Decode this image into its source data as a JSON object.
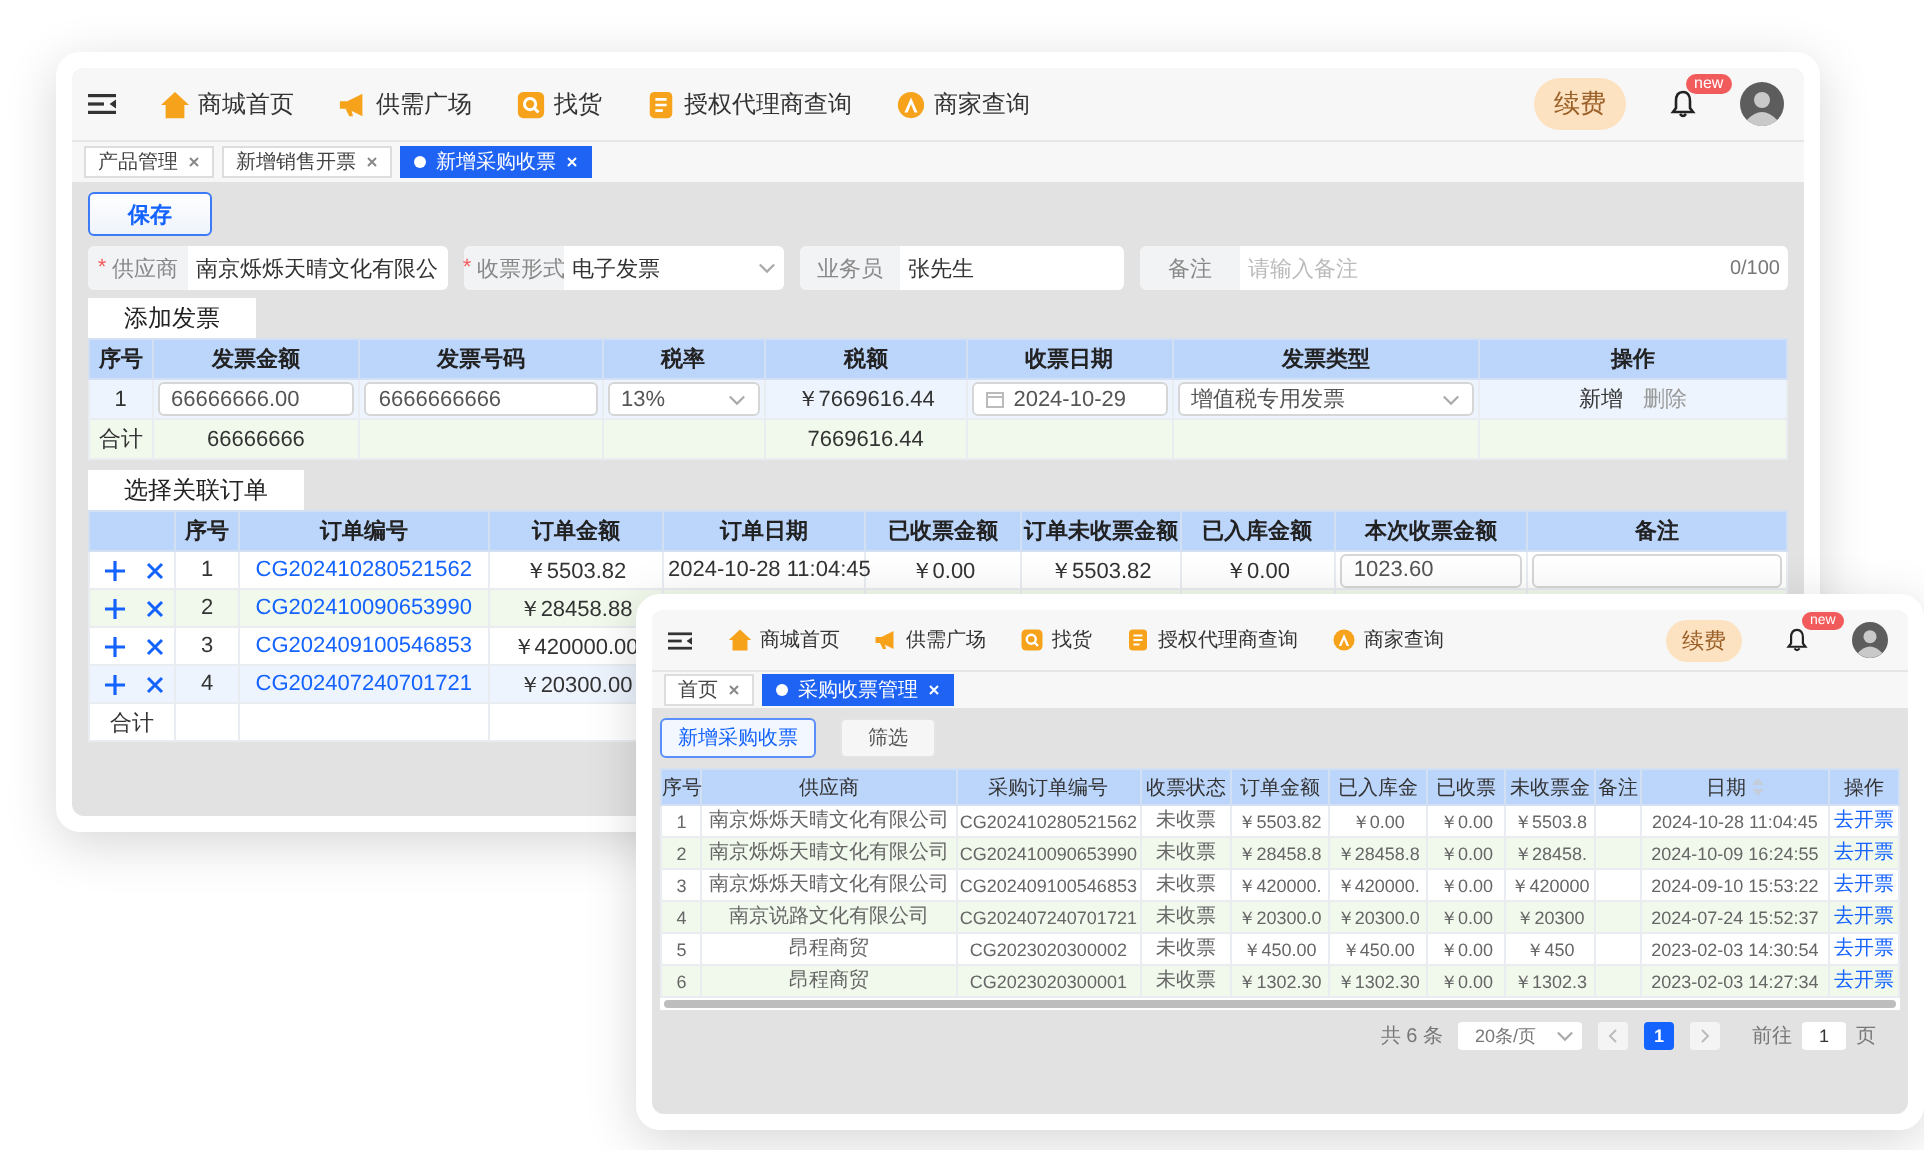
{
  "main_window": {
    "nav": {
      "items": [
        "商城首页",
        "供需广场",
        "找货",
        "授权代理商查询",
        "商家查询"
      ],
      "renew": "续费",
      "badge": "new"
    },
    "tabs": [
      {
        "label": "产品管理",
        "selected": false
      },
      {
        "label": "新增销售开票",
        "selected": false
      },
      {
        "label": "新增采购收票",
        "selected": true
      }
    ],
    "save_button": "保存",
    "form_fields": [
      {
        "kind": "text",
        "required_mark": "*",
        "label": "供应商",
        "value": "南京烁烁天晴文化有限公"
      },
      {
        "kind": "select",
        "required_mark": "*",
        "label": "收票形式",
        "value": "电子发票"
      },
      {
        "kind": "text",
        "label": "业务员",
        "value": "张先生"
      },
      {
        "kind": "text",
        "label": "备注",
        "placeholder": "请输入备注",
        "counter": "0/100"
      }
    ],
    "invoice_section": {
      "title": "添加发票",
      "columns": [
        "序号",
        "发票金额",
        "发票号码",
        "税率",
        "税额",
        "收票日期",
        "发票类型",
        "操作"
      ],
      "rows": [
        {
          "highlighted": true,
          "cells": [
            {
              "kind": "text",
              "text": "1"
            },
            {
              "kind": "input",
              "value": "66666666.00"
            },
            {
              "kind": "input",
              "value": "6666666666"
            },
            {
              "kind": "select",
              "value": "13%"
            },
            {
              "kind": "text",
              "text": "￥7669616.44"
            },
            {
              "kind": "date",
              "value": "2024-10-29"
            },
            {
              "kind": "select",
              "value": "增值税专用发票"
            },
            {
              "kind": "actions",
              "actions": [
                {
                  "label": "新增",
                  "disabled": false
                },
                {
                  "label": "删除",
                  "disabled": true
                }
              ]
            }
          ]
        },
        {
          "highlighted": false,
          "cells": [
            {
              "kind": "text",
              "text": "合计"
            },
            {
              "kind": "text",
              "text": "66666666"
            },
            {
              "kind": "empty"
            },
            {
              "kind": "empty"
            },
            {
              "kind": "text",
              "text": "7669616.44"
            }
          ]
        }
      ]
    },
    "order_section": {
      "title": "选择关联订单",
      "columns": [
        "",
        "序号",
        "订单编号",
        "订单金额",
        "订单日期",
        "已收票金额",
        "订单未收票金额",
        "已入库金额",
        "本次收票金额",
        "备注"
      ],
      "rows": [
        {
          "highlighted": false,
          "cells": [
            {
              "kind": "controls"
            },
            {
              "kind": "text",
              "text": "1"
            },
            {
              "kind": "link",
              "text": "CG202410280521562"
            },
            {
              "kind": "text",
              "text": "￥5503.82"
            },
            {
              "kind": "text",
              "text": "2024-10-28 11:04:45"
            },
            {
              "kind": "text",
              "text": "￥0.00"
            },
            {
              "kind": "text",
              "text": "￥5503.82"
            },
            {
              "kind": "text",
              "text": "￥0.00"
            },
            {
              "kind": "input",
              "value": "1023.60"
            },
            {
              "kind": "input"
            }
          ]
        },
        {
          "highlighted": false,
          "cells": [
            {
              "kind": "controls"
            },
            {
              "kind": "text",
              "text": "2"
            },
            {
              "kind": "link",
              "text": "CG202410090653990"
            },
            {
              "kind": "text",
              "text": "￥28458.88"
            }
          ]
        },
        {
          "highlighted": false,
          "cells": [
            {
              "kind": "controls"
            },
            {
              "kind": "text",
              "text": "3"
            },
            {
              "kind": "link",
              "text": "CG202409100546853"
            },
            {
              "kind": "text",
              "text": "￥420000.00"
            }
          ]
        },
        {
          "highlighted": true,
          "cells": [
            {
              "kind": "controls"
            },
            {
              "kind": "text",
              "text": "4"
            },
            {
              "kind": "link",
              "text": "CG202407240701721"
            },
            {
              "kind": "text",
              "text": "￥20300.00"
            }
          ]
        },
        {
          "highlighted": false,
          "cells": [
            {
              "kind": "text",
              "text": "合计"
            }
          ]
        }
      ]
    }
  },
  "second_window": {
    "nav": {
      "items": [
        "商城首页",
        "供需广场",
        "找货",
        "授权代理商查询",
        "商家查询"
      ],
      "renew": "续费",
      "badge": "new"
    },
    "tabs": [
      {
        "label": "首页",
        "selected": false
      },
      {
        "label": "采购收票管理",
        "selected": true
      }
    ],
    "buttons": [
      {
        "label": "新增采购收票",
        "kind": "primary"
      },
      {
        "label": "筛选",
        "kind": "plain"
      }
    ],
    "columns": [
      {
        "label": "序号"
      },
      {
        "label": "供应商"
      },
      {
        "label": "采购订单编号"
      },
      {
        "label": "收票状态"
      },
      {
        "label": "订单金额"
      },
      {
        "label": "已入库金"
      },
      {
        "label": "已收票"
      },
      {
        "label": "未收票金"
      },
      {
        "label": "备注"
      },
      {
        "label": "日期",
        "sortable": true
      },
      {
        "label": "操作"
      }
    ],
    "rows": [
      {
        "cells": [
          {
            "kind": "text",
            "text": "1"
          },
          {
            "kind": "text",
            "text": "南京烁烁天晴文化有限公司"
          },
          {
            "kind": "text",
            "text": "CG202410280521562"
          },
          {
            "kind": "text",
            "text": "未收票"
          },
          {
            "kind": "text",
            "text": "￥5503.82"
          },
          {
            "kind": "text",
            "text": "￥0.00"
          },
          {
            "kind": "text",
            "text": "￥0.00"
          },
          {
            "kind": "text",
            "text": "￥5503.8"
          },
          {
            "kind": "empty"
          },
          {
            "kind": "text",
            "text": "2024-10-28 11:04:45"
          },
          {
            "kind": "link",
            "text": "去开票"
          }
        ]
      },
      {
        "cells": [
          {
            "kind": "text",
            "text": "2"
          },
          {
            "kind": "text",
            "text": "南京烁烁天晴文化有限公司"
          },
          {
            "kind": "text",
            "text": "CG202410090653990"
          },
          {
            "kind": "text",
            "text": "未收票"
          },
          {
            "kind": "text",
            "text": "￥28458.8"
          },
          {
            "kind": "text",
            "text": "￥28458.8"
          },
          {
            "kind": "text",
            "text": "￥0.00"
          },
          {
            "kind": "text",
            "text": "￥28458."
          },
          {
            "kind": "empty"
          },
          {
            "kind": "text",
            "text": "2024-10-09 16:24:55"
          },
          {
            "kind": "link",
            "text": "去开票"
          }
        ]
      },
      {
        "cells": [
          {
            "kind": "text",
            "text": "3"
          },
          {
            "kind": "text",
            "text": "南京烁烁天晴文化有限公司"
          },
          {
            "kind": "text",
            "text": "CG202409100546853"
          },
          {
            "kind": "text",
            "text": "未收票"
          },
          {
            "kind": "text",
            "text": "￥420000."
          },
          {
            "kind": "text",
            "text": "￥420000."
          },
          {
            "kind": "text",
            "text": "￥0.00"
          },
          {
            "kind": "text",
            "text": "￥420000"
          },
          {
            "kind": "empty"
          },
          {
            "kind": "text",
            "text": "2024-09-10 15:53:22"
          },
          {
            "kind": "link",
            "text": "去开票"
          }
        ]
      },
      {
        "cells": [
          {
            "kind": "text",
            "text": "4"
          },
          {
            "kind": "text",
            "text": "南京说路文化有限公司"
          },
          {
            "kind": "text",
            "text": "CG202407240701721"
          },
          {
            "kind": "text",
            "text": "未收票"
          },
          {
            "kind": "text",
            "text": "￥20300.0"
          },
          {
            "kind": "text",
            "text": "￥20300.0"
          },
          {
            "kind": "text",
            "text": "￥0.00"
          },
          {
            "kind": "text",
            "text": "￥20300"
          },
          {
            "kind": "empty"
          },
          {
            "kind": "text",
            "text": "2024-07-24 15:52:37"
          },
          {
            "kind": "link",
            "text": "去开票"
          }
        ]
      },
      {
        "cells": [
          {
            "kind": "text",
            "text": "5"
          },
          {
            "kind": "text",
            "text": "昂程商贸"
          },
          {
            "kind": "text",
            "text": "CG2023020300002"
          },
          {
            "kind": "text",
            "text": "未收票"
          },
          {
            "kind": "text",
            "text": "￥450.00"
          },
          {
            "kind": "text",
            "text": "￥450.00"
          },
          {
            "kind": "text",
            "text": "￥0.00"
          },
          {
            "kind": "text",
            "text": "￥450"
          },
          {
            "kind": "empty"
          },
          {
            "kind": "text",
            "text": "2023-02-03 14:30:54"
          },
          {
            "kind": "link",
            "text": "去开票"
          }
        ]
      },
      {
        "cells": [
          {
            "kind": "text",
            "text": "6"
          },
          {
            "kind": "text",
            "text": "昂程商贸"
          },
          {
            "kind": "text",
            "text": "CG2023020300001"
          },
          {
            "kind": "text",
            "text": "未收票"
          },
          {
            "kind": "text",
            "text": "￥1302.30"
          },
          {
            "kind": "text",
            "text": "￥1302.30"
          },
          {
            "kind": "text",
            "text": "￥0.00"
          },
          {
            "kind": "text",
            "text": "￥1302.3"
          },
          {
            "kind": "empty"
          },
          {
            "kind": "text",
            "text": "2023-02-03 14:27:34"
          },
          {
            "kind": "link",
            "text": "去开票"
          }
        ]
      }
    ],
    "pagination": {
      "total": "共 6 条",
      "page_size": "20条/页",
      "pages": [
        {
          "label": "1",
          "selected": true
        }
      ],
      "goto_label": "前往",
      "goto_value": "1",
      "page_unit": "页"
    }
  }
}
